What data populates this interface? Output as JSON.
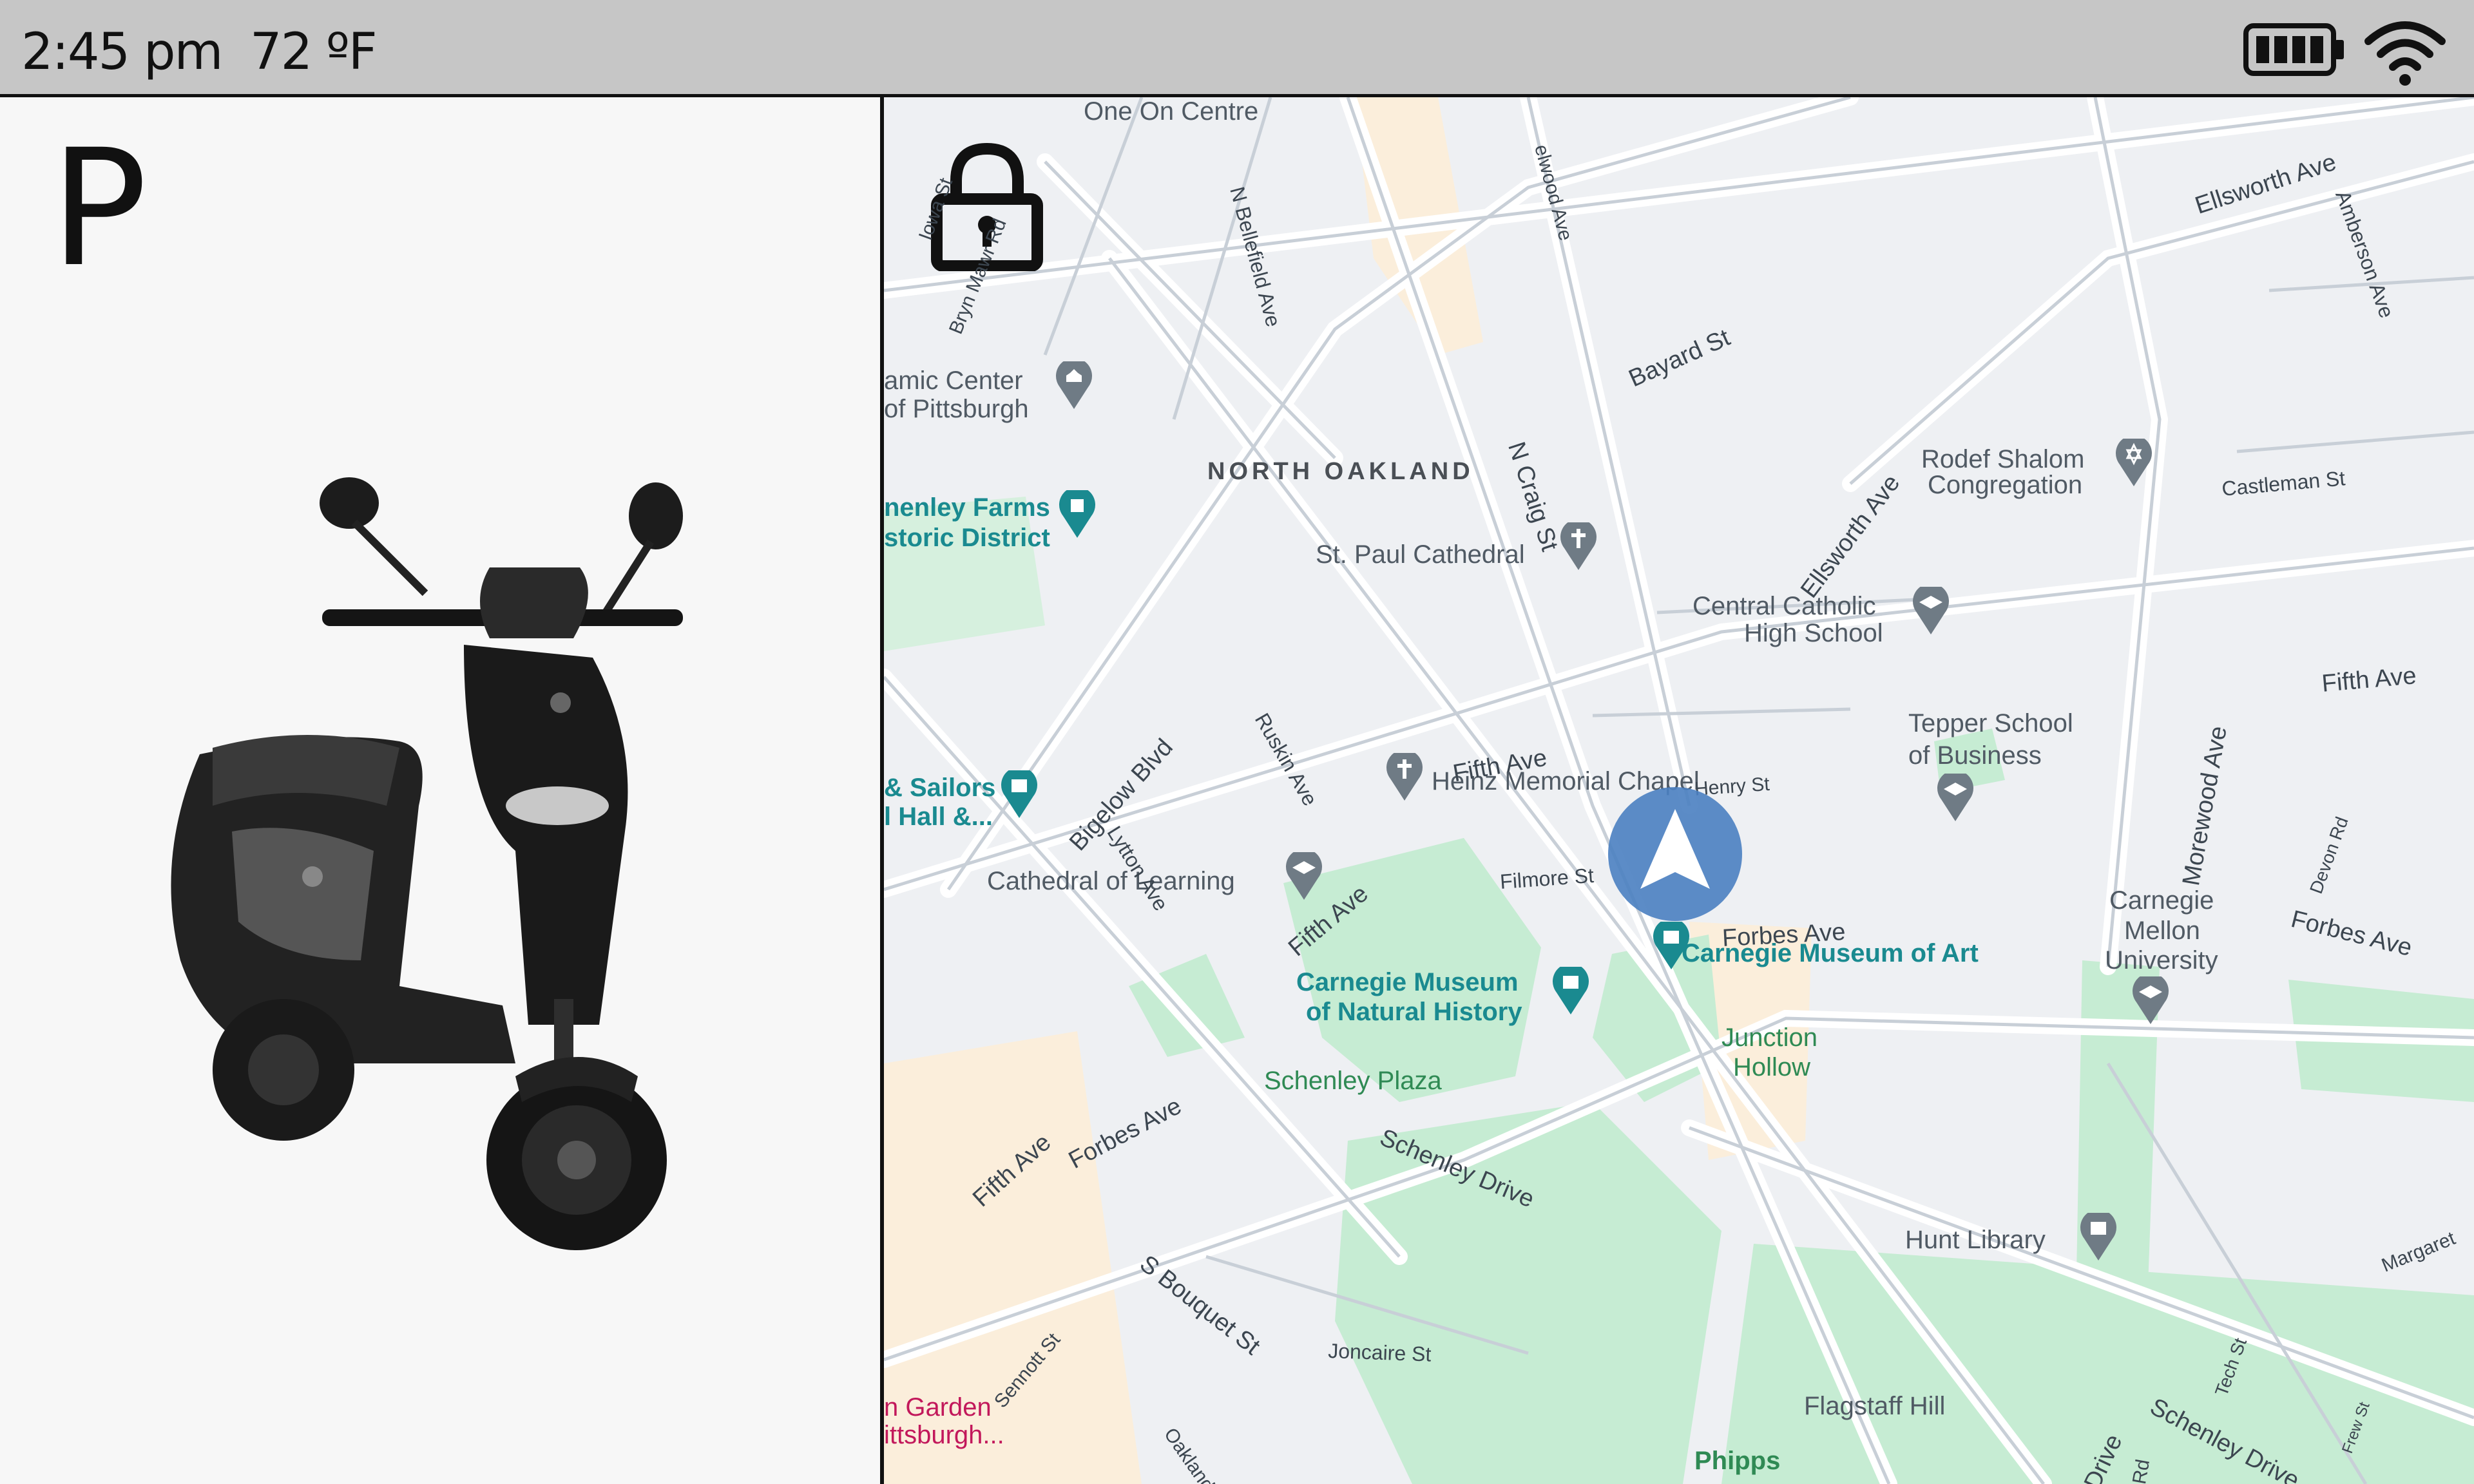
{
  "status": {
    "time": "2:45 pm",
    "temperature": "72 ºF",
    "battery_icon": "battery-icon",
    "wifi_icon": "wifi-icon"
  },
  "vehicle": {
    "gear": "P",
    "image": "scooter-image"
  },
  "map": {
    "lock_icon": "lock-icon",
    "position_icon": "navigation-arrow-icon",
    "district": "NORTH OAKLAND",
    "places": {
      "one_on_centre": "One On Centre",
      "islamic_center_1": "amic Center",
      "islamic_center_2": "of Pittsburgh",
      "schenley_farms_1": "nenley Farms",
      "schenley_farms_2": "storic District",
      "st_paul": "St. Paul Cathedral",
      "rodef_1": "Rodef Shalom",
      "rodef_2": "Congregation",
      "central_catholic_1": "Central Catholic",
      "central_catholic_2": "High School",
      "tepper_1": "Tepper School",
      "tepper_2": "of Business",
      "heinz": "Heinz Memorial Chapel",
      "sailors_1": "& Sailors",
      "sailors_2": "l Hall &...",
      "cathedral_learning": "Cathedral of Learning",
      "cmu_1": "Carnegie",
      "cmu_2": "Mellon",
      "cmu_3": "University",
      "museum_art": "Carnegie Museum of Art",
      "museum_nat_1": "Carnegie Museum",
      "museum_nat_2": "of Natural History",
      "junction_1": "Junction",
      "junction_2": "Hollow",
      "schenley_plaza": "Schenley Plaza",
      "hunt_library": "Hunt Library",
      "flagstaff": "Flagstaff Hill",
      "phipps": "Phipps",
      "garden_1": "n Garden",
      "garden_2": "ittsburgh..."
    },
    "streets": {
      "iowa": "Iowa St",
      "bryn_mawr": "Bryn Mawr Rd",
      "n_bellefield": "N Bellefield Ave",
      "elwood": "elwood Ave",
      "bayard": "Bayard St",
      "ellsworth_1": "Ellsworth Ave",
      "ellsworth_2": "Ellsworth Ave",
      "amberson": "Amberson Ave",
      "castleman": "Castleman St",
      "n_craig": "N Craig St",
      "fifth_1": "Fifth Ave",
      "fifth_2": "Fifth Ave",
      "fifth_3": "Fifth Ave",
      "fifth_4": "Fifth Ave",
      "henry": "Henry St",
      "ruskin": "Ruskin Ave",
      "bigelow": "Bigelow Blvd",
      "lytton": "Lytton Ave",
      "morewood": "Morewood Ave",
      "devon": "Devon Rd",
      "filmore": "Filmore St",
      "forbes_1": "Forbes Ave",
      "forbes_2": "Forbes Ave",
      "forbes_3": "Forbes Ave",
      "schenley_drive_1": "Schenley Drive",
      "schenley_drive_2": "Schenley Drive",
      "margaret": "Margaret",
      "tech": "Tech St",
      "frew": "Frew St",
      "sennott": "Sennott St",
      "s_bouquet": "S Bouquet St",
      "joncaire": "Joncaire St",
      "oakland": "Oakland",
      "drive": "Drive",
      "rd": "Rd"
    },
    "colors": {
      "park": "#c6ecd3",
      "campus": "#fbeedb",
      "road": "#ffffff",
      "poi_teal": "#1a8a90",
      "poi_gray": "#6f7b85",
      "position": "#4a7fc1"
    }
  }
}
